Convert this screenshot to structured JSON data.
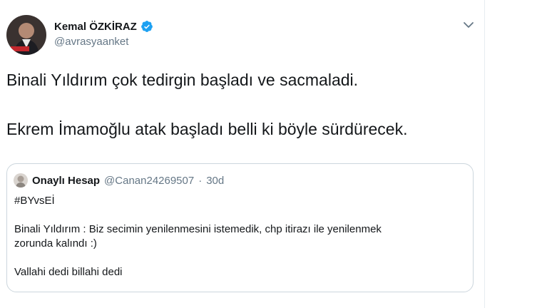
{
  "author": {
    "name": "Kemal ÖZKİRAZ",
    "handle": "@avrasyaanket",
    "verified": true
  },
  "tweet": {
    "lines": [
      "Binali Yıldırım çok tedirgin başladı ve sacmaladi.",
      "Ekrem İmamoğlu atak başladı belli ki böyle sürdürecek."
    ]
  },
  "quote": {
    "name": "Onaylı Hesap",
    "handle": "@Canan24269507",
    "separator": "·",
    "time": "30d",
    "hashtag": "#BYvsEİ",
    "body_line1": "Binali Yıldırım : Biz secimin yenilenmesini istemedik, chp itirazı ile yenilenmek",
    "body_line2": "zorunda kalındı :)",
    "body_line3": "Vallahi dedi billahi dedi"
  },
  "colors": {
    "verified": "#1da1f2",
    "secondary_text": "#657786",
    "border": "#ccd6dd"
  },
  "icons": {
    "verified": "verified-badge-icon",
    "menu": "chevron-down-icon"
  }
}
